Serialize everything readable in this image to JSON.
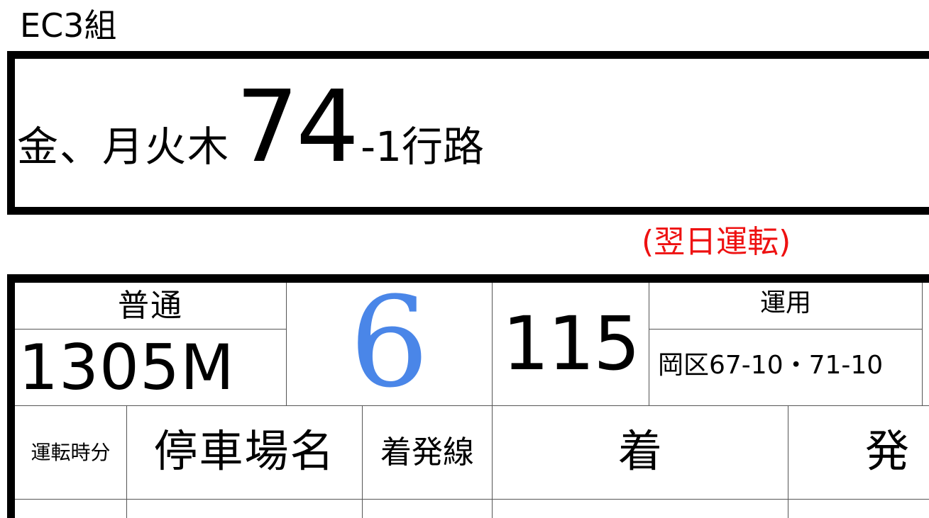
{
  "group_label": "EC3組",
  "route": {
    "days": "金、月火木",
    "number": "74",
    "suffix": "-1行路"
  },
  "next_day_note": "(翌日運転)",
  "train": {
    "type": "普通",
    "number": "1305M",
    "car_count": "6",
    "series": "115",
    "usage_label": "運用",
    "usage_value": "岡区67-10・71-10"
  },
  "table_headers": {
    "run_time": "運転時分",
    "station_name": "停車場名",
    "arrival_track": "着発線",
    "arrive": "着",
    "depart": "発"
  },
  "colors": {
    "car_count": "#4a86e8",
    "next_day_note": "#ee1111"
  }
}
